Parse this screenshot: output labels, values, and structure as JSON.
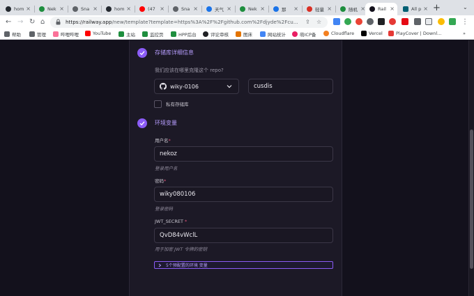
{
  "browser": {
    "tabs": [
      {
        "label": "hom",
        "favicon_color": "#24292f"
      },
      {
        "label": "Nek",
        "favicon_color": "#1e8e3e"
      },
      {
        "label": "Sna",
        "favicon_color": "#5f6368"
      },
      {
        "label": "hom",
        "favicon_color": "#24292f"
      },
      {
        "label": "(47",
        "favicon_color": "#ff0000"
      },
      {
        "label": "Sna",
        "favicon_color": "#5f6368"
      },
      {
        "label": "天气",
        "favicon_color": "#1a73e8"
      },
      {
        "label": "Nek",
        "favicon_color": "#1e8e3e"
      },
      {
        "label": "那",
        "favicon_color": "#1a73e8"
      },
      {
        "label": "轻量",
        "favicon_color": "#d93025"
      },
      {
        "label": "随机",
        "favicon_color": "#1e8e3e"
      },
      {
        "label": "Rail",
        "favicon_color": "#13111c",
        "active": true
      },
      {
        "label": "All p",
        "favicon_color": "#005f73"
      }
    ],
    "url_host": "https://railway.app",
    "url_path": "/new/template?template=https%3A%2F%2Fgithub.com%2Fdjyde%2Fcu...",
    "bookmarks": [
      {
        "label": "帮助",
        "icon_color": "#5f6368"
      },
      {
        "label": "管理",
        "icon_color": "#5f6368"
      },
      {
        "label": "哔哩哔哩",
        "icon_color": "#fb7299"
      },
      {
        "label": "YouTube",
        "icon_color": "#ff0000"
      },
      {
        "label": "主站",
        "icon_color": "#1e8e3e"
      },
      {
        "label": "监控页",
        "icon_color": "#1e8e3e"
      },
      {
        "label": "HPP后台",
        "icon_color": "#1e8e3e"
      },
      {
        "label": "评论审核",
        "icon_color": "#202124"
      },
      {
        "label": "图床",
        "icon_color": "#e37400"
      },
      {
        "label": "网站统计",
        "icon_color": "#4285f4"
      },
      {
        "label": "萌ICP备",
        "icon_color": "#e91e63"
      },
      {
        "label": "Cloudflare",
        "icon_color": "#f38020"
      },
      {
        "label": "Vercel",
        "icon_color": "#000000"
      },
      {
        "label": "PlayCover | Downl...",
        "icon_color": "#e53935"
      }
    ],
    "bookmarks_more": "»"
  },
  "form": {
    "repo_section": {
      "title": "存储库详细信息",
      "question": "我们应该在哪里克隆这个 repo?",
      "owner_value": "wiky-0106",
      "repo_value": "cusdis",
      "private_label": "私有存储库"
    },
    "env_section": {
      "title": "环境变量",
      "fields": [
        {
          "label": "用户名",
          "value": "nekoz",
          "helper": "登录用户名"
        },
        {
          "label": "密码",
          "value": "wiky080106",
          "helper": "登录密码"
        },
        {
          "label": "JWT_SECRET",
          "value": "QvD84vWclL",
          "helper": "用于加密 JWT 令牌的密钥"
        }
      ],
      "required_mark": "*",
      "preconfigured_toggle": "5个预配置的环境 变量"
    }
  },
  "colors": {
    "accent": "#8b5cf6",
    "page_bg": "#13111c",
    "panel_bg": "#1c1926"
  }
}
